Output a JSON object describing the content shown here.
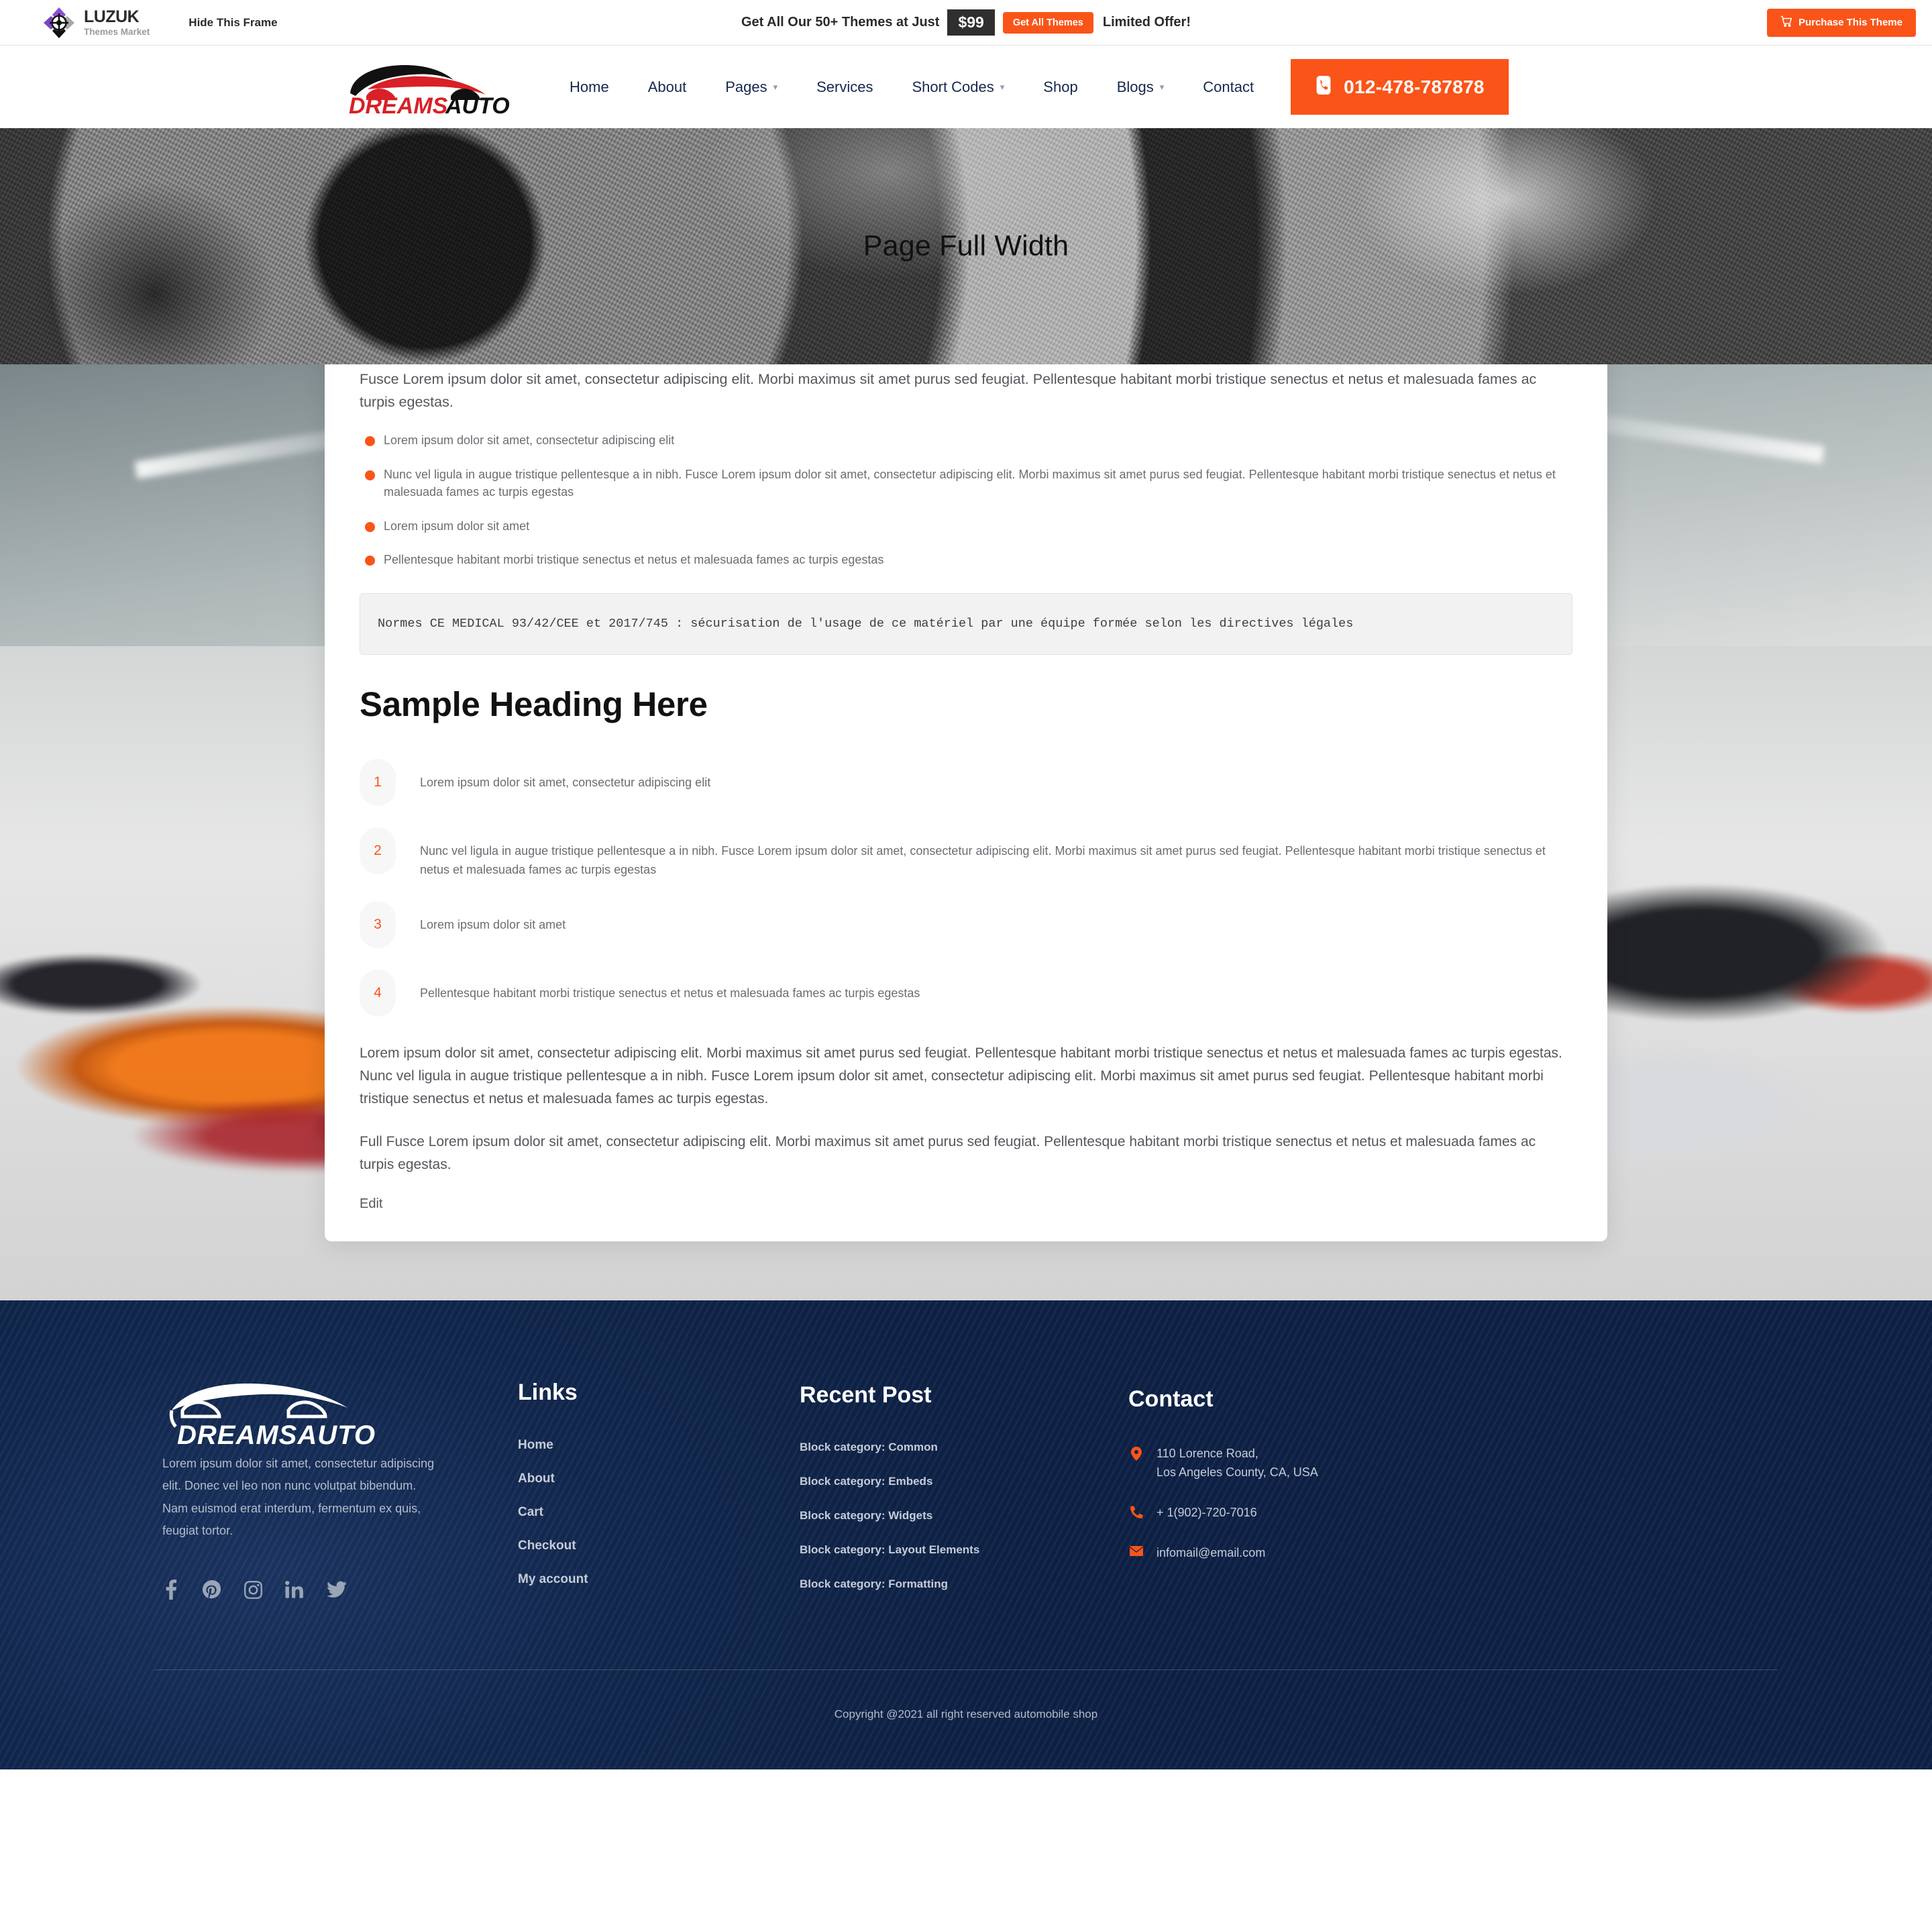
{
  "promo": {
    "brand_name": "LUZUK",
    "brand_sub": "Themes Market",
    "hide_frame_label": "Hide This Frame",
    "offer_text": "Get All Our 50+ Themes at Just",
    "price": "$99",
    "cta_label": "Get All Themes",
    "limited_label": "Limited Offer!",
    "purchase_label": "Purchase This Theme",
    "accent": "#fa5419",
    "price_bg": "#2f2f2f"
  },
  "header": {
    "logo_dreams": "DREAMS",
    "logo_auto": "AUTO",
    "nav": [
      {
        "label": "Home",
        "has_caret": false
      },
      {
        "label": "About",
        "has_caret": false
      },
      {
        "label": "Pages",
        "has_caret": true
      },
      {
        "label": "Services",
        "has_caret": false
      },
      {
        "label": "Short Codes",
        "has_caret": true
      },
      {
        "label": "Shop",
        "has_caret": false
      },
      {
        "label": "Blogs",
        "has_caret": true
      },
      {
        "label": "Contact",
        "has_caret": false
      }
    ],
    "phone": "012-478-787878",
    "nav_color": "#16284f"
  },
  "hero": {
    "title": "Page Full Width"
  },
  "content": {
    "lead": "Fusce Lorem ipsum dolor sit amet, consectetur adipiscing elit. Morbi maximus sit amet purus sed feugiat. Pellentesque habitant morbi tristique senectus et netus et malesuada fames ac turpis egestas.",
    "bullets": [
      "Lorem ipsum dolor sit amet, consectetur adipiscing elit",
      "Nunc vel ligula in augue tristique pellentesque a in nibh. Fusce Lorem ipsum dolor sit amet, consectetur adipiscing elit. Morbi maximus sit amet purus sed feugiat. Pellentesque habitant morbi tristique senectus et netus et malesuada fames ac turpis egestas",
      "Lorem ipsum dolor sit amet",
      "Pellentesque habitant morbi tristique senectus et netus et malesuada fames ac turpis egestas"
    ],
    "code": "Normes CE MEDICAL 93/42/CEE et 2017/745 : sécurisation de l'usage de ce matériel par une équipe formée selon les directives légales",
    "heading": "Sample Heading Here",
    "numbered": [
      {
        "n": "1",
        "text": "Lorem ipsum dolor sit amet, consectetur adipiscing elit"
      },
      {
        "n": "2",
        "text": "Nunc vel ligula in augue tristique pellentesque a in nibh. Fusce Lorem ipsum dolor sit amet, consectetur adipiscing elit. Morbi maximus sit amet purus sed feugiat. Pellentesque habitant morbi tristique senectus et netus et malesuada fames ac turpis egestas"
      },
      {
        "n": "3",
        "text": "Lorem ipsum dolor sit amet"
      },
      {
        "n": "4",
        "text": "Pellentesque habitant morbi tristique senectus et netus et malesuada fames ac turpis egestas"
      }
    ],
    "para1": "Lorem ipsum dolor sit amet, consectetur adipiscing elit. Morbi maximus sit amet purus sed feugiat. Pellentesque habitant morbi tristique senectus et netus et malesuada fames ac turpis egestas. Nunc vel ligula in augue tristique pellentesque a in nibh. Fusce Lorem ipsum dolor sit amet, consectetur adipiscing elit. Morbi maximus sit amet purus sed feugiat. Pellentesque habitant morbi tristique senectus et netus et malesuada fames ac turpis egestas.",
    "para2": "Full Fusce Lorem ipsum dolor sit amet, consectetur adipiscing elit. Morbi maximus sit amet purus sed feugiat. Pellentesque habitant morbi tristique senectus et netus et malesuada fames ac turpis egestas.",
    "edit_label": "Edit"
  },
  "footer": {
    "logo_text": "DREAMSAUTO",
    "description": "Lorem ipsum dolor sit amet, consectetur adipiscing elit. Donec vel leo non nunc volutpat bibendum. Nam euismod erat interdum, fermentum ex quis, feugiat tortor.",
    "social": [
      "facebook-icon",
      "pinterest-icon",
      "instagram-icon",
      "linkedin-icon",
      "twitter-icon"
    ],
    "links_title": "Links",
    "links": [
      "Home",
      "About",
      "Cart",
      "Checkout",
      "My account"
    ],
    "recent_title": "Recent Post",
    "recent": [
      "Block category: Common",
      "Block category: Embeds",
      "Block category: Widgets",
      "Block category: Layout Elements",
      "Block category: Formatting"
    ],
    "contact_title": "Contact",
    "address_line1": "110 Lorence Road,",
    "address_line2": "Los Angeles County, CA, USA",
    "phone": "+ 1(902)-720-7016",
    "email": "infomail@email.com",
    "copyright": "Copyright @2021 all right reserved automobile shop",
    "bg": "#11254c",
    "accent": "#fa5419"
  }
}
